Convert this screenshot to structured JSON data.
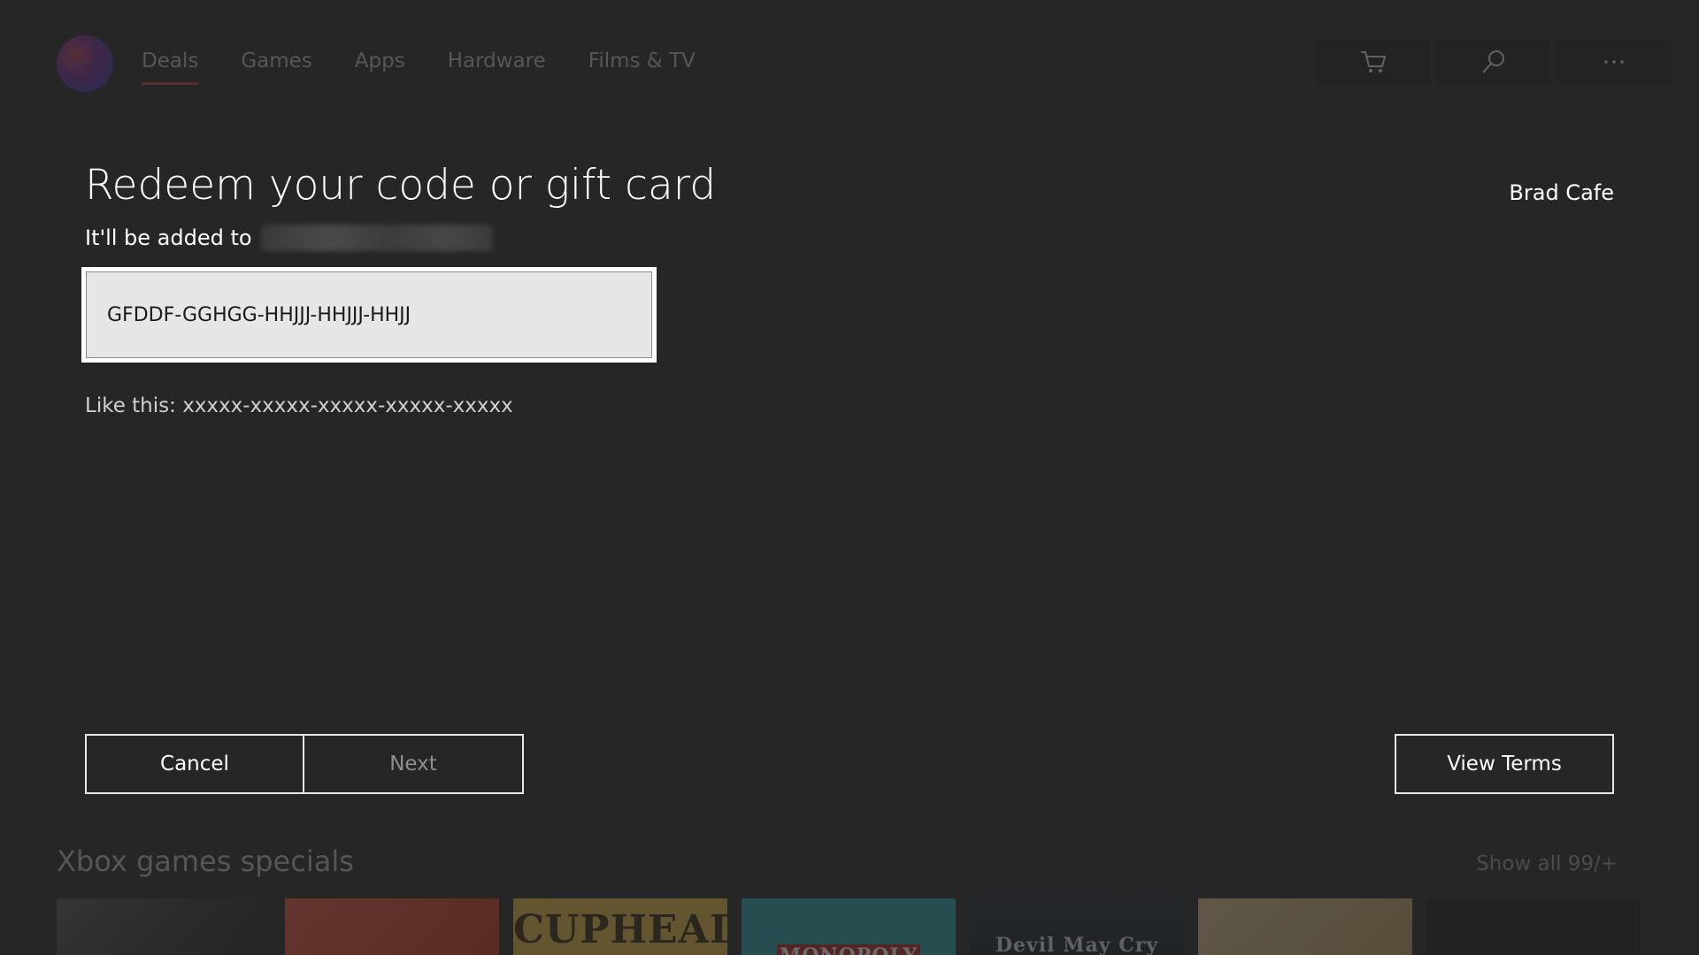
{
  "nav": {
    "items": [
      {
        "label": "Deals",
        "active": true
      },
      {
        "label": "Games",
        "active": false
      },
      {
        "label": "Apps",
        "active": false
      },
      {
        "label": "Hardware",
        "active": false
      },
      {
        "label": "Films & TV",
        "active": false
      }
    ],
    "actions": {
      "cart": "cart-icon",
      "search": "search-icon",
      "more": "more-icon"
    }
  },
  "dialog": {
    "title": "Redeem your code or gift card",
    "subtitle": "It'll be added to",
    "account_name": "Brad Cafe",
    "code_value": "GFDDF-GGHGG-HHJJJ-HHJJJ-HHJJ",
    "hint": "Like this: xxxxx-xxxxx-xxxxx-xxxxx-xxxxx",
    "buttons": {
      "cancel": "Cancel",
      "next": "Next",
      "view_terms": "View Terms"
    }
  },
  "background": {
    "section_title": "Xbox games specials",
    "show_all": "Show all 99/+",
    "tiles": [
      "",
      "",
      "CUPHEAD",
      "MONOPOLY",
      "Devil May Cry",
      "",
      ""
    ]
  },
  "colors": {
    "background": "#262626",
    "accent_underline": "#c43a3a",
    "field_bg": "#e6e6e6"
  }
}
